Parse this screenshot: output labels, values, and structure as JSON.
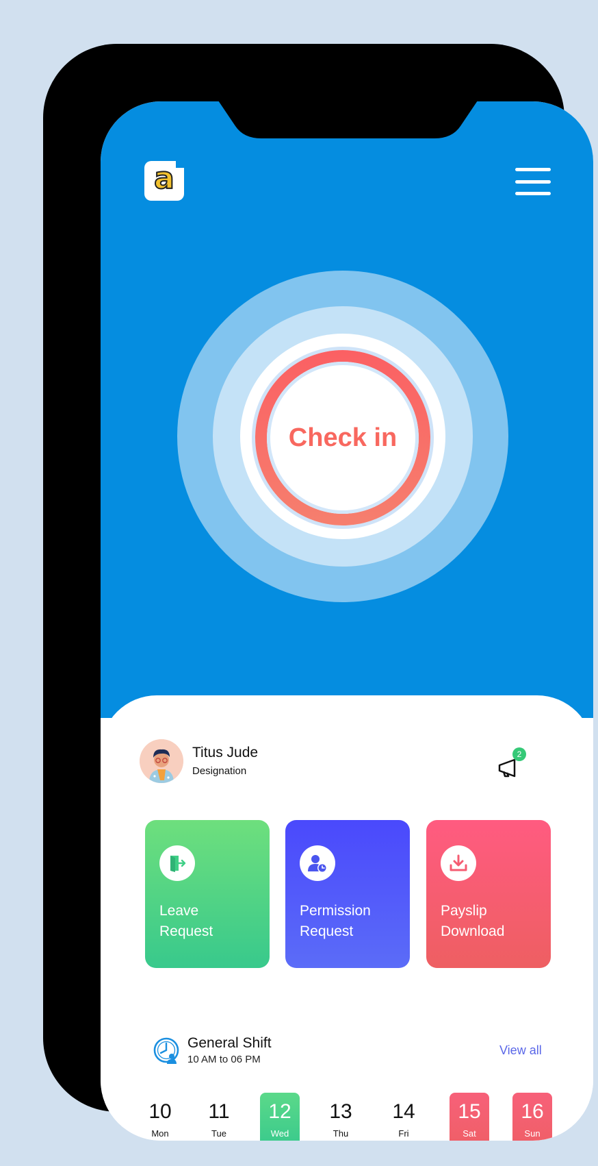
{
  "app": {
    "logo_letter": "a",
    "accent": "#058de0"
  },
  "header": {
    "menu_icon": "hamburger-menu-icon"
  },
  "checkin": {
    "label": "Check in",
    "color": "#f8685f"
  },
  "user": {
    "name": "Titus Jude",
    "designation": "Designation"
  },
  "notifications": {
    "count": "2",
    "icon": "megaphone-icon"
  },
  "actions": [
    {
      "line1": "Leave",
      "line2": "Request",
      "icon": "exit-door-icon",
      "color": "#38c98c"
    },
    {
      "line1": "Permission",
      "line2": "Request",
      "icon": "user-clock-icon",
      "color": "#4a49fc"
    },
    {
      "line1": "Payslip",
      "line2": "Download",
      "icon": "download-icon",
      "color": "#ff5b80"
    }
  ],
  "shift": {
    "title": "General Shift",
    "time": "10 AM to 06 PM",
    "view_all": "View all"
  },
  "calendar": {
    "days": [
      {
        "num": "10",
        "dow": "Mon"
      },
      {
        "num": "11",
        "dow": "Tue"
      },
      {
        "num": "12",
        "dow": "Wed"
      },
      {
        "num": "13",
        "dow": "Thu"
      },
      {
        "num": "14",
        "dow": "Fri"
      },
      {
        "num": "15",
        "dow": "Sat"
      },
      {
        "num": "16",
        "dow": "Sun"
      }
    ]
  }
}
